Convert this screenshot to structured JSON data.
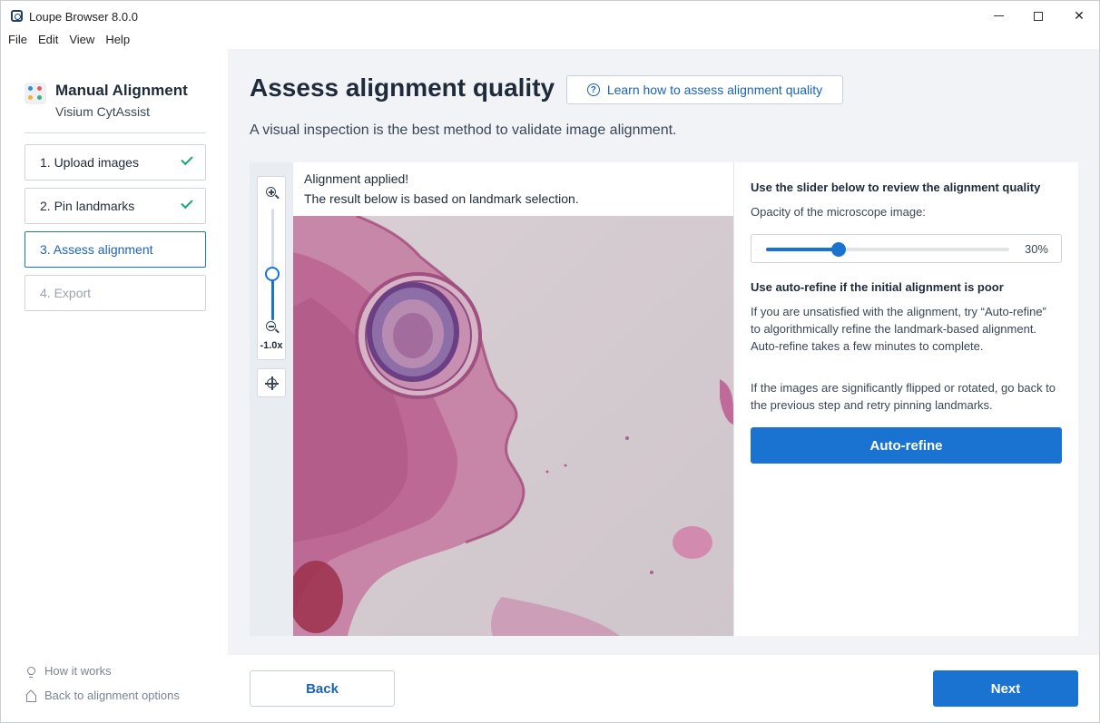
{
  "window": {
    "title": "Loupe Browser 8.0.0",
    "controls": {
      "minimize": "",
      "maximize": "",
      "close": "✕"
    }
  },
  "menu": [
    "File",
    "Edit",
    "View",
    "Help"
  ],
  "sidebar": {
    "title": "Manual Alignment",
    "subtitle": "Visium CytAssist",
    "steps": [
      {
        "label": "1. Upload images",
        "state": "done"
      },
      {
        "label": "2. Pin landmarks",
        "state": "done"
      },
      {
        "label": "3. Assess alignment",
        "state": "active"
      },
      {
        "label": "4. Export",
        "state": "disabled"
      }
    ],
    "links": {
      "how_it_works": "How it works",
      "back_options": "Back to alignment options"
    }
  },
  "main": {
    "title": "Assess alignment quality",
    "learn_button": "Learn how to assess alignment quality",
    "subtitle": "A visual inspection is the best method to validate image alignment.",
    "viewer": {
      "zoom_level": "-1.0x",
      "message_line1": "Alignment applied!",
      "message_line2": "The result below is based on landmark selection."
    },
    "right_panel": {
      "slider_heading": "Use the slider below to review the alignment quality",
      "opacity_label": "Opacity of the microscope image:",
      "opacity_value": "30%",
      "opacity_fraction": 0.3,
      "autorefine_heading": "Use auto-refine if the initial alignment is poor",
      "autorefine_p1": "If you are unsatisfied with the alignment, try “Auto-refine” to algorithmically refine the landmark-based alignment. Auto-refine takes a few minutes to complete.",
      "autorefine_p2": "If the images are significantly flipped or rotated, go back to the previous step and retry pinning landmarks.",
      "autorefine_button": "Auto-refine"
    }
  },
  "footer": {
    "back": "Back",
    "next": "Next"
  },
  "colors": {
    "accent": "#1a73d1",
    "check": "#1aa37a",
    "tissue": "#c9608f"
  }
}
